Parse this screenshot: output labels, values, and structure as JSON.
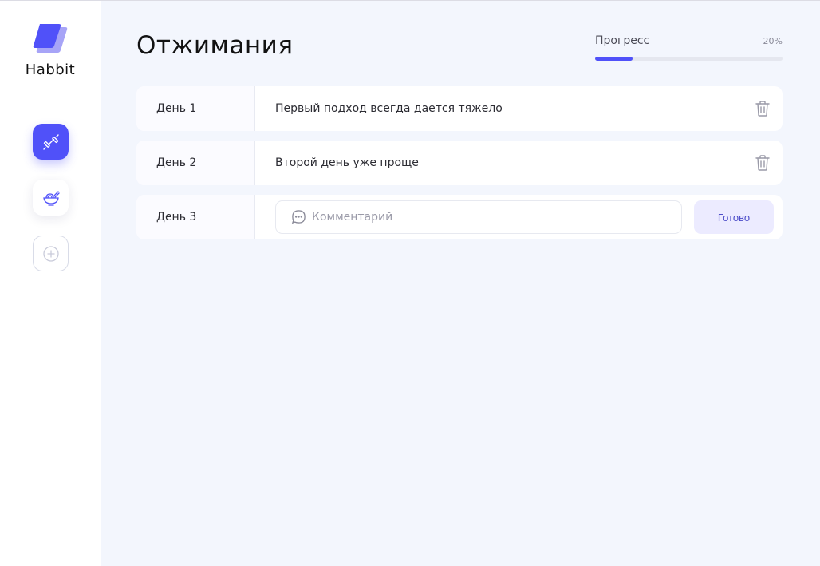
{
  "app": {
    "logo_text": "Habbit"
  },
  "sidebar": {
    "items": [
      {
        "icon": "dumbbell-icon",
        "active": true
      },
      {
        "icon": "food-bowl-icon",
        "active": false
      },
      {
        "icon": "add-icon",
        "active": false
      }
    ]
  },
  "header": {
    "title": "Отжимания",
    "progress_label": "Прогресс",
    "progress_percent_text": "20%",
    "progress_value": 0.2
  },
  "days": [
    {
      "label": "День 1",
      "comment": "Первый подход всегда дается тяжело"
    },
    {
      "label": "День 2",
      "comment": "Второй день уже проще"
    }
  ],
  "new_day": {
    "label": "День 3",
    "placeholder": "Комментарий",
    "submit_label": "Готово"
  },
  "colors": {
    "accent": "#5051F9",
    "background": "#F3F6FD",
    "sidebar": "#FFFFFF",
    "button_light": "#ECEBFF"
  }
}
